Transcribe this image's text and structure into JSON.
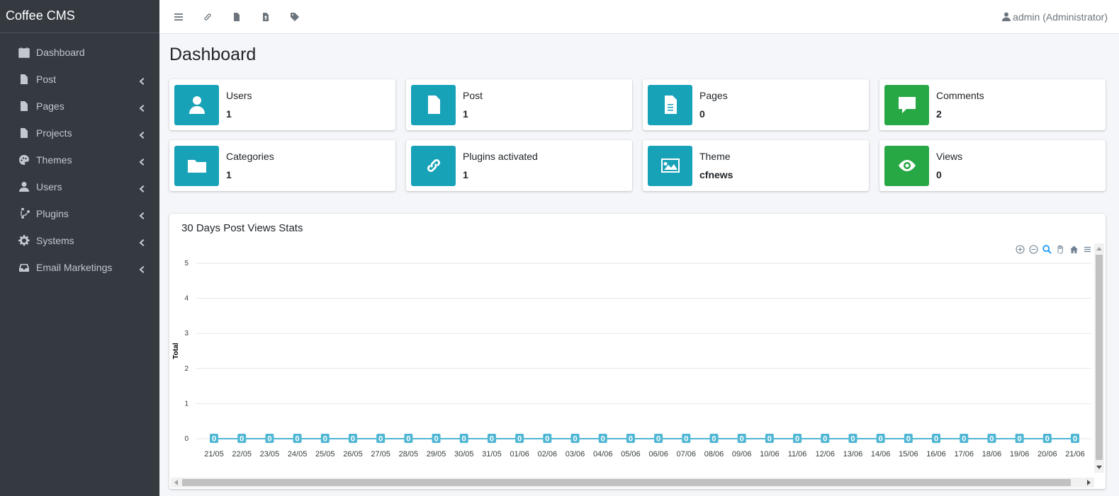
{
  "brand": "Coffee CMS",
  "sidebar": {
    "items": [
      {
        "label": "Dashboard",
        "icon": "calendar-icon",
        "has_children": false
      },
      {
        "label": "Post",
        "icon": "file-icon",
        "has_children": true
      },
      {
        "label": "Pages",
        "icon": "file-icon",
        "has_children": true
      },
      {
        "label": "Projects",
        "icon": "file-icon",
        "has_children": true
      },
      {
        "label": "Themes",
        "icon": "palette-icon",
        "has_children": true
      },
      {
        "label": "Users",
        "icon": "user-icon",
        "has_children": true
      },
      {
        "label": "Plugins",
        "icon": "branch-icon",
        "has_children": true
      },
      {
        "label": "Systems",
        "icon": "gear-icon",
        "has_children": true
      },
      {
        "label": "Email Marketings",
        "icon": "inbox-icon",
        "has_children": true
      }
    ]
  },
  "topbar": {
    "icons": [
      "menu-icon",
      "link-icon",
      "file-icon",
      "file-upload-icon",
      "tag-icon"
    ],
    "user": "admin (Administrator)"
  },
  "page_title": "Dashboard",
  "info_boxes": [
    {
      "label": "Users",
      "value": "1",
      "icon": "user-icon",
      "color": "#17a2b8"
    },
    {
      "label": "Post",
      "value": "1",
      "icon": "file-icon",
      "color": "#17a2b8"
    },
    {
      "label": "Pages",
      "value": "0",
      "icon": "file-text-icon",
      "color": "#17a2b8"
    },
    {
      "label": "Comments",
      "value": "2",
      "icon": "comment-icon",
      "color": "#28a745"
    },
    {
      "label": "Categories",
      "value": "1",
      "icon": "folder-icon",
      "color": "#17a2b8"
    },
    {
      "label": "Plugins activated",
      "value": "1",
      "icon": "link-icon",
      "color": "#17a2b8"
    },
    {
      "label": "Theme",
      "value": "cfnews",
      "icon": "image-icon",
      "color": "#17a2b8"
    },
    {
      "label": "Views",
      "value": "0",
      "icon": "eye-icon",
      "color": "#28a745"
    }
  ],
  "chart_title": "30 Days Post Views Stats",
  "chart_data": {
    "type": "line",
    "title": "30 Days Post Views Stats",
    "ylabel": "Total",
    "xlabel": "",
    "ylim": [
      0,
      5
    ],
    "yticks": [
      0,
      1,
      2,
      3,
      4,
      5
    ],
    "categories": [
      "21/05",
      "22/05",
      "23/05",
      "24/05",
      "25/05",
      "26/05",
      "27/05",
      "28/05",
      "29/05",
      "30/05",
      "31/05",
      "01/06",
      "02/06",
      "03/06",
      "04/06",
      "05/06",
      "06/06",
      "07/06",
      "08/06",
      "09/06",
      "10/06",
      "11/06",
      "12/06",
      "13/06",
      "14/06",
      "15/06",
      "16/06",
      "17/06",
      "18/06",
      "19/06",
      "20/06",
      "21/06"
    ],
    "series": [
      {
        "values": [
          0,
          0,
          0,
          0,
          0,
          0,
          0,
          0,
          0,
          0,
          0,
          0,
          0,
          0,
          0,
          0,
          0,
          0,
          0,
          0,
          0,
          0,
          0,
          0,
          0,
          0,
          0,
          0,
          0,
          0,
          0,
          0
        ],
        "color": "#4fb6d3"
      }
    ],
    "data_labels": true,
    "grid": true
  }
}
